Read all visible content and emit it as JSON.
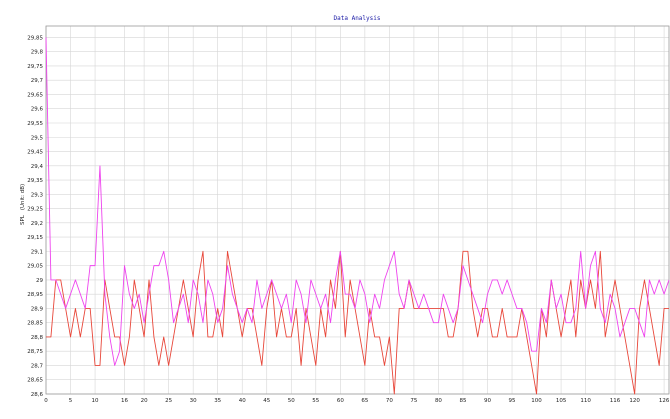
{
  "chart_data": {
    "type": "line",
    "title": "Data Analysis",
    "xlabel": "",
    "ylabel": "SPL",
    "ylabel_unit": "(Unit: dB)",
    "xlim": [
      0,
      127
    ],
    "ylim": [
      28.6,
      29.89
    ],
    "x_ticks": [
      0,
      5,
      10,
      16,
      20,
      25,
      30,
      35,
      40,
      45,
      50,
      55,
      60,
      65,
      70,
      75,
      80,
      85,
      90,
      95,
      100,
      105,
      110,
      116,
      120,
      126
    ],
    "y_ticks": [
      "28,6",
      "28,65",
      "28,7",
      "28,75",
      "28,8",
      "28,85",
      "28,9",
      "28,95",
      "29",
      "29,05",
      "29,1",
      "29,15",
      "29,2",
      "29,25",
      "29,3",
      "29,35",
      "29,4",
      "29,45",
      "29,5",
      "29,55",
      "29,6",
      "29,65",
      "29,7",
      "29,75",
      "29,8",
      "29,85"
    ],
    "y_tick_values": [
      28.6,
      28.65,
      28.7,
      28.75,
      28.8,
      28.85,
      28.9,
      28.95,
      29.0,
      29.05,
      29.1,
      29.15,
      29.2,
      29.25,
      29.3,
      29.35,
      29.4,
      29.45,
      29.5,
      29.55,
      29.6,
      29.65,
      29.7,
      29.75,
      29.8,
      29.85
    ],
    "grid": true,
    "legend": "none",
    "series": [
      {
        "color": "#e8473a",
        "values": [
          28.8,
          28.8,
          29.0,
          29.0,
          28.9,
          28.8,
          28.9,
          28.8,
          28.9,
          28.9,
          28.7,
          28.7,
          29.0,
          28.9,
          28.8,
          28.8,
          28.7,
          28.8,
          29.0,
          28.9,
          28.8,
          29.0,
          28.8,
          28.7,
          28.8,
          28.7,
          28.8,
          28.9,
          29.0,
          28.9,
          28.8,
          29.0,
          29.1,
          28.8,
          28.8,
          28.9,
          28.8,
          29.1,
          29.0,
          28.9,
          28.8,
          28.9,
          28.9,
          28.8,
          28.7,
          28.9,
          29.0,
          28.8,
          28.9,
          28.8,
          28.8,
          28.9,
          28.7,
          28.9,
          28.8,
          28.7,
          28.9,
          28.8,
          29.0,
          28.9,
          29.1,
          28.8,
          29.0,
          28.9,
          28.8,
          28.7,
          28.9,
          28.8,
          28.8,
          28.7,
          28.8,
          28.6,
          28.9,
          28.9,
          29.0,
          28.9,
          28.9,
          28.9,
          28.9,
          28.9,
          28.9,
          28.9,
          28.8,
          28.8,
          28.9,
          29.1,
          29.1,
          28.9,
          28.8,
          28.9,
          28.9,
          28.8,
          28.8,
          28.9,
          28.8,
          28.8,
          28.8,
          28.9,
          28.8,
          28.7,
          28.6,
          28.9,
          28.8,
          29.0,
          28.9,
          28.8,
          28.9,
          29.0,
          28.8,
          29.0,
          28.9,
          29.0,
          28.9,
          29.1,
          28.8,
          28.9,
          29.0,
          28.9,
          28.8,
          28.7,
          28.6,
          28.9,
          29.0,
          28.9,
          28.8,
          28.7,
          28.9,
          28.9
        ]
      },
      {
        "color": "#ee44ee",
        "values": [
          29.85,
          29.0,
          29.0,
          28.95,
          28.9,
          28.95,
          29.0,
          28.95,
          28.9,
          29.05,
          29.05,
          29.4,
          28.95,
          28.8,
          28.7,
          28.75,
          29.05,
          28.95,
          28.9,
          28.95,
          28.85,
          28.95,
          29.05,
          29.05,
          29.1,
          29.0,
          28.85,
          28.9,
          28.95,
          28.85,
          29.0,
          28.95,
          28.85,
          29.0,
          28.95,
          28.85,
          28.9,
          29.05,
          28.95,
          28.9,
          28.85,
          28.9,
          28.85,
          29.0,
          28.9,
          28.95,
          29.0,
          28.95,
          28.9,
          28.95,
          28.85,
          29.0,
          28.95,
          28.85,
          29.0,
          28.95,
          28.9,
          28.95,
          28.85,
          29.0,
          29.1,
          28.95,
          28.95,
          28.9,
          29.0,
          28.95,
          28.85,
          28.95,
          28.9,
          29.0,
          29.05,
          29.1,
          28.95,
          28.9,
          29.0,
          28.95,
          28.9,
          28.95,
          28.9,
          28.85,
          28.85,
          28.95,
          28.9,
          28.85,
          28.9,
          29.05,
          29.0,
          28.95,
          28.9,
          28.85,
          28.95,
          29.0,
          29.0,
          28.95,
          29.0,
          28.95,
          28.9,
          28.9,
          28.85,
          28.75,
          28.75,
          28.9,
          28.85,
          29.0,
          28.9,
          28.95,
          28.85,
          28.85,
          28.9,
          29.1,
          28.9,
          29.05,
          29.1,
          28.9,
          28.85,
          28.95,
          28.9,
          28.8,
          28.85,
          28.9,
          28.9,
          28.85,
          28.8,
          29.0,
          28.95,
          29.0,
          28.95,
          29.0
        ]
      }
    ]
  }
}
